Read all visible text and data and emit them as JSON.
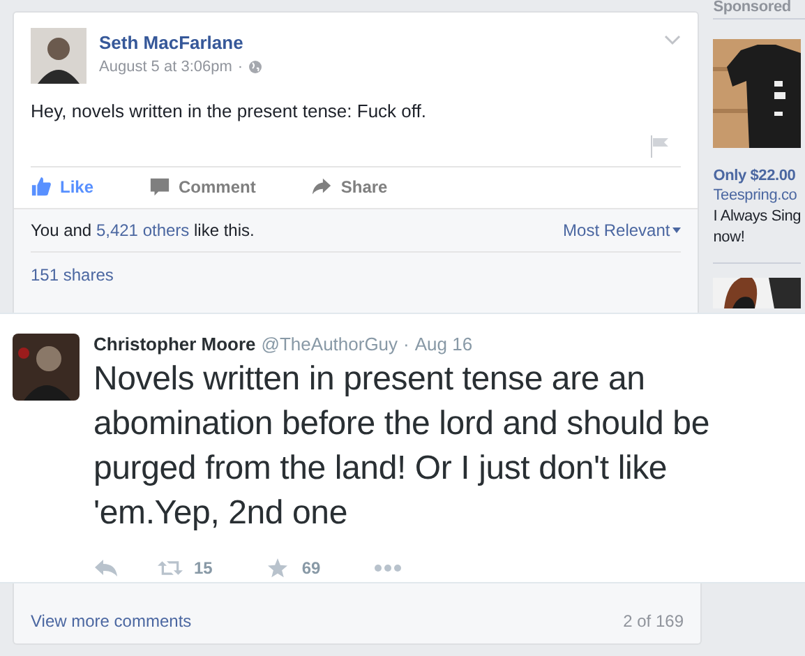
{
  "post": {
    "author": "Seth MacFarlane",
    "time": "August 5 at 3:06pm",
    "separator": "·",
    "text": "Hey, novels written in the present tense: Fuck off.",
    "actions": [
      {
        "label": "Like",
        "kind": "like",
        "selected": true
      },
      {
        "label": "Comment",
        "kind": "comment",
        "selected": false
      },
      {
        "label": "Share",
        "kind": "share",
        "selected": false
      }
    ],
    "likes": {
      "prefix": "You and",
      "link": "5,421 others",
      "suffix": "like this."
    },
    "sort": "Most Relevant",
    "shares": "151 shares"
  },
  "sidebar": {
    "heading": "Sponsored",
    "price": "Only $22.00",
    "site": "Teespring.co",
    "text": "I Always Sing",
    "text_2": "now!"
  },
  "tweet": {
    "name": "Christopher Moore",
    "handle": "@TheAuthorGuy",
    "separator": "·",
    "date": "Aug 16",
    "text": "Novels written in present tense are an abomination before the lord and should be purged from the land! Or I just don't like 'em.Yep, 2nd one",
    "retweets": "15",
    "favorites": "69"
  },
  "footer": {
    "more": "View more comments",
    "count": "2 of 169"
  }
}
